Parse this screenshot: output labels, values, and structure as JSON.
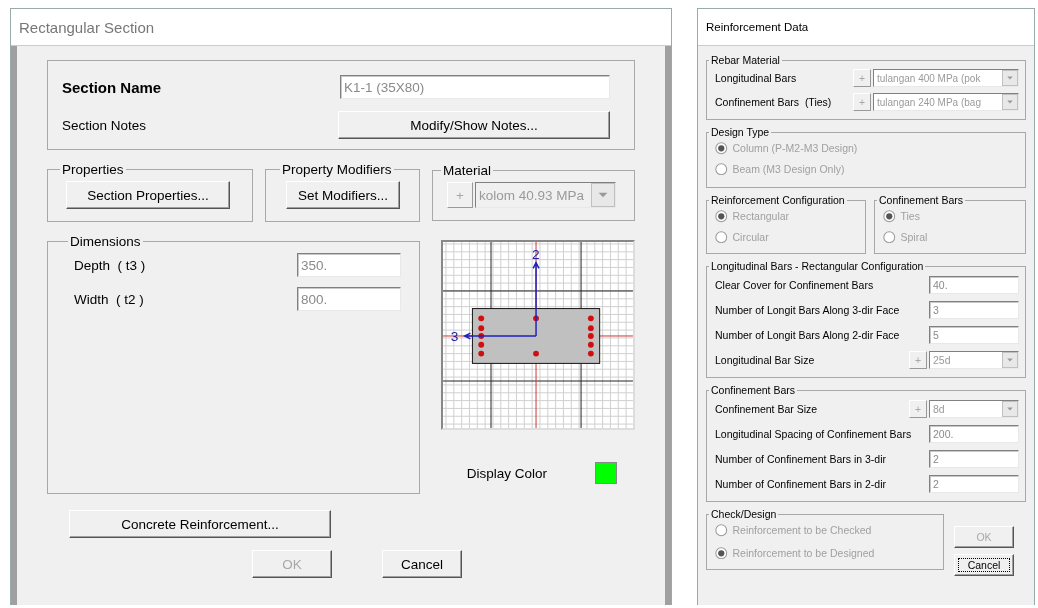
{
  "section_dialog": {
    "title": "Rectangular Section",
    "section_name": {
      "label": "Section Name",
      "value": "K1-1 (35X80)"
    },
    "section_notes": {
      "label": "Section Notes",
      "button": "Modify/Show Notes..."
    },
    "properties": {
      "title": "Properties",
      "button": "Section Properties..."
    },
    "property_modifiers": {
      "title": "Property Modifiers",
      "button": "Set Modifiers..."
    },
    "material": {
      "title": "Material",
      "plus": "+",
      "value": "kolom 40.93 MPa",
      "disabled": true
    },
    "dimensions": {
      "title": "Dimensions",
      "fields": [
        {
          "label": "Depth  ( t3 )",
          "value": "350."
        },
        {
          "label": "Width  ( t2 )",
          "value": "800."
        }
      ]
    },
    "diagram": {
      "axis_2": "2",
      "axis_3": "3"
    },
    "display_color": {
      "label": "Display Color",
      "color": "#00ff00"
    },
    "reinforcement_button": "Concrete Reinforcement...",
    "buttons": [
      {
        "label": "OK",
        "disabled": true,
        "focused": false
      },
      {
        "label": "Cancel",
        "disabled": false,
        "focused": false
      }
    ]
  },
  "reinforcement_dialog": {
    "title": "Reinforcement Data",
    "rebar_material": {
      "title": "Rebar Material",
      "rows": [
        {
          "label": "Longitudinal Bars",
          "plus": "+",
          "value": "tulangan 400 MPa (pok"
        },
        {
          "label": "Confinement Bars  (Ties)",
          "plus": "+",
          "value": "tulangan 240 MPa (bag"
        }
      ]
    },
    "design_type": {
      "title": "Design Type",
      "disabled": true,
      "options": [
        {
          "label": "Column  (P-M2-M3 Design)",
          "selected": true
        },
        {
          "label": "Beam  (M3 Design Only)",
          "selected": false
        }
      ]
    },
    "configuration": {
      "title": "Reinforcement Configuration",
      "disabled": true,
      "options": [
        {
          "label": "Rectangular",
          "selected": true
        },
        {
          "label": "Circular",
          "selected": false
        }
      ]
    },
    "confinement_type": {
      "title": "Confinement Bars",
      "disabled": true,
      "options": [
        {
          "label": "Ties",
          "selected": true
        },
        {
          "label": "Spiral",
          "selected": false
        }
      ]
    },
    "longitudinal": {
      "title": "Longitudinal Bars - Rectangular Configuration",
      "rows": [
        {
          "kind": "field",
          "label": "Clear Cover for Confinement Bars",
          "value": "40."
        },
        {
          "kind": "field",
          "label": "Number of Longit Bars Along 3-dir Face",
          "value": "3"
        },
        {
          "kind": "field",
          "label": "Number of Longit Bars Along 2-dir Face",
          "value": "5"
        },
        {
          "kind": "dropdown",
          "label": "Longitudinal Bar Size",
          "plus": "+",
          "value": "25d"
        }
      ]
    },
    "confinement": {
      "title": "Confinement Bars",
      "rows": [
        {
          "kind": "dropdown",
          "label": "Confinement Bar Size",
          "plus": "+",
          "value": "8d"
        },
        {
          "kind": "field",
          "label": "Longitudinal Spacing of Confinement Bars",
          "value": "200."
        },
        {
          "kind": "field",
          "label": "Number of Confinement Bars in 3-dir",
          "value": "2"
        },
        {
          "kind": "field",
          "label": "Number of Confinement Bars in 2-dir",
          "value": "2"
        }
      ]
    },
    "check_design": {
      "title": "Check/Design",
      "disabled": true,
      "options": [
        {
          "label": "Reinforcement to be Checked",
          "selected": false
        },
        {
          "label": "Reinforcement to be Designed",
          "selected": true
        }
      ]
    },
    "buttons": [
      {
        "label": "OK",
        "disabled": true,
        "focused": false
      },
      {
        "label": "Cancel",
        "disabled": false,
        "focused": true
      }
    ]
  }
}
